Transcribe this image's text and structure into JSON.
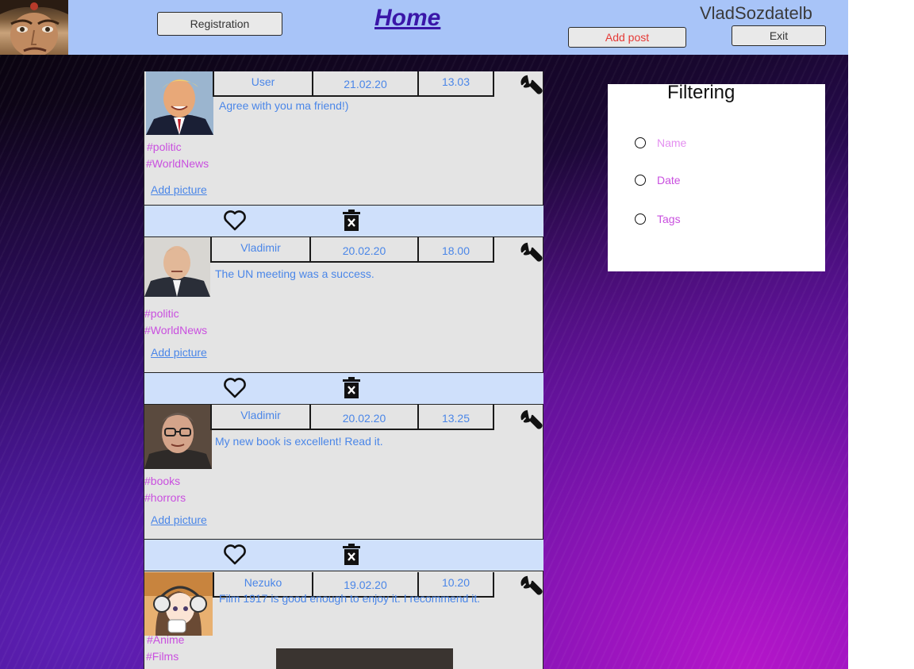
{
  "header": {
    "registration_label": "Registration",
    "home_label": "Home",
    "username": "VladSozdatelb",
    "add_post_label": "Add post",
    "exit_label": "Exit"
  },
  "posts": [
    {
      "author": "User",
      "date": "21.02.20",
      "time": "13.03",
      "text": "Agree with you ma friend!)",
      "tags": [
        "#politic",
        "#WorldNews"
      ],
      "add_picture_label": "Add picture"
    },
    {
      "author": "Vladimir",
      "date": "20.02.20",
      "time": "18.00",
      "text": "The UN meeting was a success.",
      "tags": [
        "#politic",
        "#WorldNews"
      ],
      "add_picture_label": "Add picture"
    },
    {
      "author": "Vladimir",
      "date": "20.02.20",
      "time": "13.25",
      "text": "My new book is excellent! Read it.",
      "tags": [
        "#books",
        "#horrors"
      ],
      "add_picture_label": "Add picture"
    },
    {
      "author": "Nezuko",
      "date": "19.02.20",
      "time": "10.20",
      "text": "Film 1917 is good enough to enjoy it. I recommend it.",
      "tags": [
        "#Anime",
        "#Films"
      ]
    }
  ],
  "filter": {
    "title": "Filtering",
    "options": [
      {
        "label": "Name",
        "color": "#e48ff0"
      },
      {
        "label": "Date",
        "color": "#c94fdf"
      },
      {
        "label": "Tags",
        "color": "#c94fdf"
      }
    ]
  },
  "icons": {
    "edit": "wrench-icon",
    "like": "heart-icon",
    "delete": "trash-icon"
  },
  "colors": {
    "header_bg": "#a8c4f8",
    "post_bg": "#e4e4e4",
    "actionbar_bg": "#cfe0fb",
    "post_text": "#4a86e8",
    "tag": "#c94fdf",
    "add_post_text": "#e53935",
    "home_link": "#3a16a8"
  }
}
